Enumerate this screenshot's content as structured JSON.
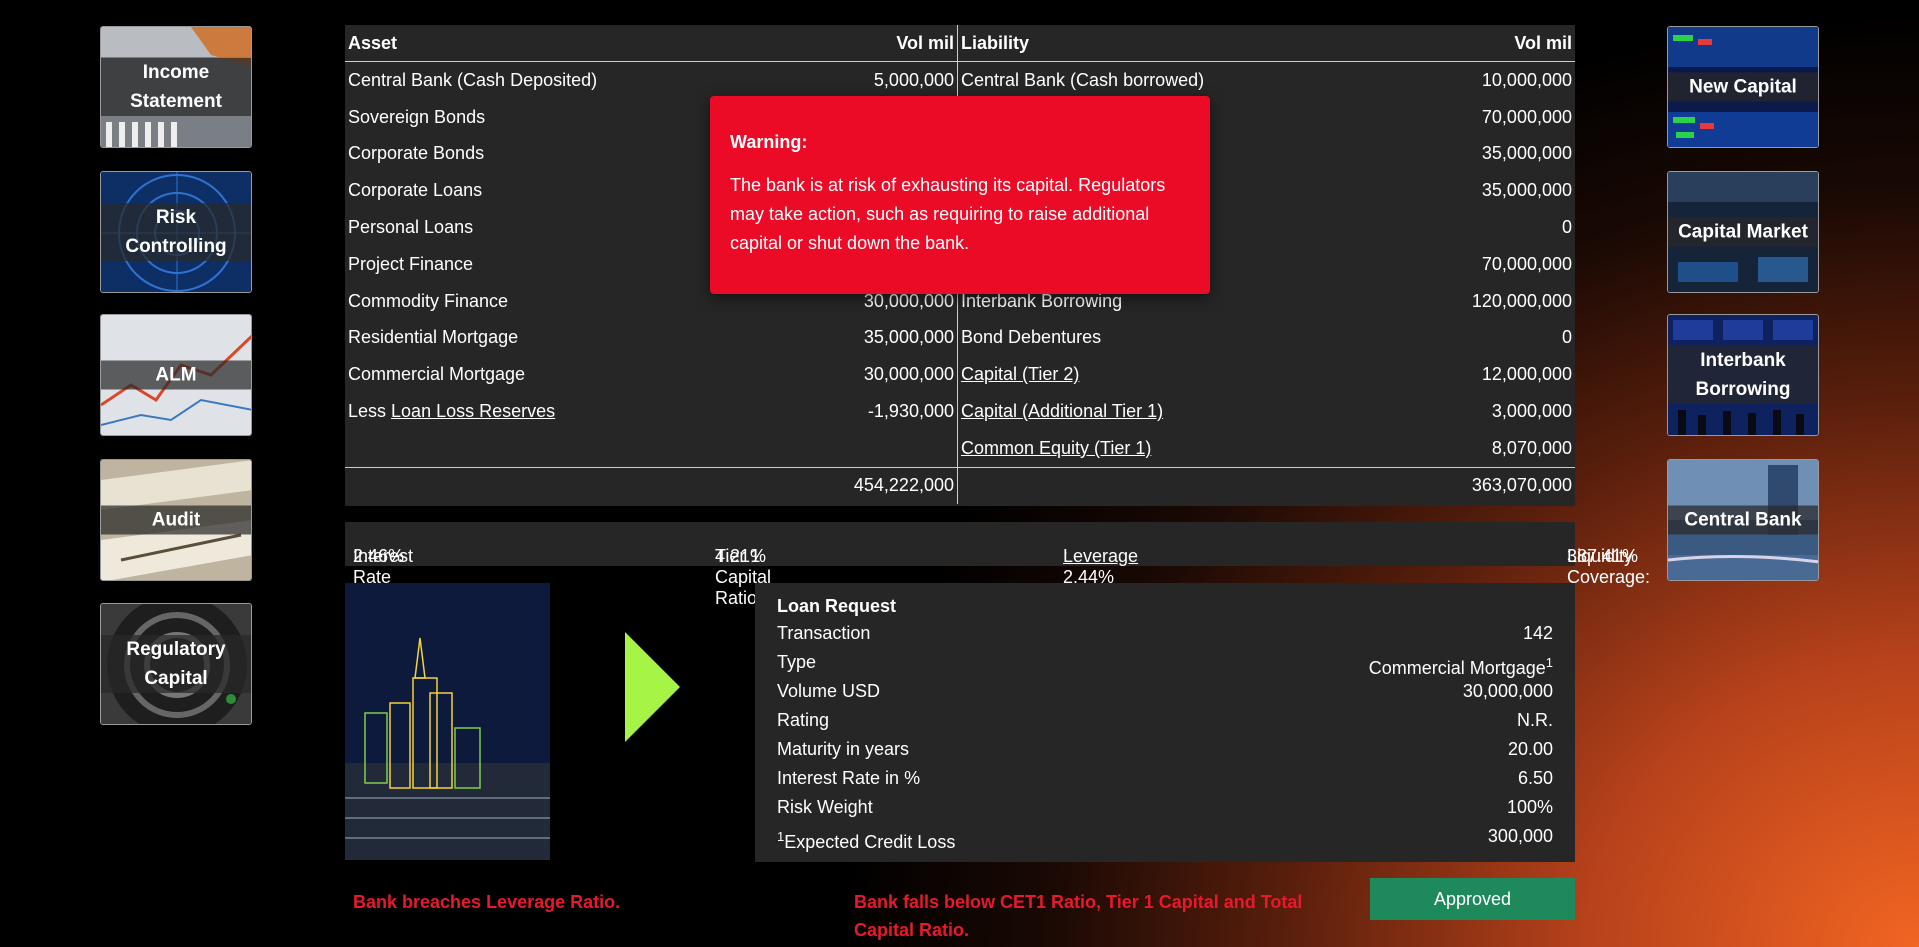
{
  "left_nav": [
    {
      "label": "Income Statement"
    },
    {
      "label": "Risk Controlling"
    },
    {
      "label": "ALM"
    },
    {
      "label": "Audit"
    },
    {
      "label": "Regulatory Capital"
    }
  ],
  "right_nav": [
    {
      "label": "New Capital"
    },
    {
      "label": "Capital Market"
    },
    {
      "label": "Interbank Borrowing"
    },
    {
      "label": "Central Bank"
    }
  ],
  "balance_sheet": {
    "headers": {
      "asset": "Asset",
      "asset_vol": "Vol mil",
      "liability": "Liability",
      "liability_vol": "Vol mil"
    },
    "assets": [
      {
        "name": "Central Bank (Cash Deposited)",
        "vol": "5,000,000"
      },
      {
        "name": "Sovereign Bonds",
        "vol": ""
      },
      {
        "name": "Corporate Bonds",
        "vol": ""
      },
      {
        "name": "Corporate Loans",
        "vol": ""
      },
      {
        "name": "Personal Loans",
        "vol": ""
      },
      {
        "name": "Project Finance",
        "vol": ""
      },
      {
        "name": "Commodity Finance",
        "vol": "30,000,000"
      },
      {
        "name": "Residential Mortgage",
        "vol": "35,000,000"
      },
      {
        "name": "Commercial Mortgage",
        "vol": "30,000,000"
      },
      {
        "prefix": "Less ",
        "name": "Loan Loss Reserves",
        "vol": "-1,930,000"
      },
      {
        "name": "",
        "vol": ""
      }
    ],
    "liabilities": [
      {
        "name": "Central Bank (Cash borrowed)",
        "vol": "10,000,000",
        "link": false
      },
      {
        "name": "",
        "vol": "70,000,000",
        "link": false
      },
      {
        "name": "",
        "vol": "35,000,000",
        "link": false
      },
      {
        "name": "",
        "vol": "35,000,000",
        "link": false
      },
      {
        "name": "",
        "vol": "0",
        "link": false
      },
      {
        "name": "",
        "vol": "70,000,000",
        "link": false
      },
      {
        "name": "Interbank Borrowing",
        "vol": "120,000,000",
        "link": false
      },
      {
        "name": "Bond Debentures",
        "vol": "0",
        "link": false
      },
      {
        "name": "Capital (Tier 2)",
        "vol": "12,000,000",
        "link": true
      },
      {
        "name": "Capital (Additional Tier 1)",
        "vol": "3,000,000",
        "link": true
      },
      {
        "name": "Common Equity (Tier 1)",
        "vol": "8,070,000",
        "link": true
      }
    ],
    "total_assets": "454,222,000",
    "total_liabilities": "363,070,000"
  },
  "ratios": {
    "irm_label": "Interest Rate Margin:",
    "irm": "2.46%",
    "t1_label": "Tier 1 Capital Ratio:",
    "t1": "4.21%",
    "lev_label": "Leverage",
    "lev": ": 2.44%",
    "lcr_label": "Liquidity Coverage:",
    "lcr": "387.41%"
  },
  "loan": {
    "title": "Loan Request",
    "rows": [
      {
        "label": "Transaction",
        "value": "142"
      },
      {
        "label": "Type",
        "value": "Commercial Mortgage",
        "sup": "1"
      },
      {
        "label": "Volume USD",
        "value": "30,000,000"
      },
      {
        "label": "Rating",
        "value": "N.R."
      },
      {
        "label": "Maturity in years",
        "value": "20.00"
      },
      {
        "label": "Interest Rate in %",
        "value": "6.50"
      },
      {
        "label": "Risk Weight",
        "value": "100%"
      },
      {
        "label": "Expected Credit Loss",
        "value": "300,000",
        "pre_sup": "1"
      }
    ]
  },
  "warnings": {
    "leverage": "Bank breaches Leverage Ratio.",
    "capital": "Bank falls below CET1 Ratio, Tier 1 Capital and Total Capital Ratio."
  },
  "approve_label": "Approved",
  "modal": {
    "title": "Warning:",
    "body": "The bank is at risk of exhausting its capital. Regulators may take action, such as requiring to raise additional capital or shut down the bank."
  },
  "colors": {
    "accent_green": "#1e8a5c",
    "warning_red": "#e8192c",
    "arrow": "#a6f546"
  }
}
